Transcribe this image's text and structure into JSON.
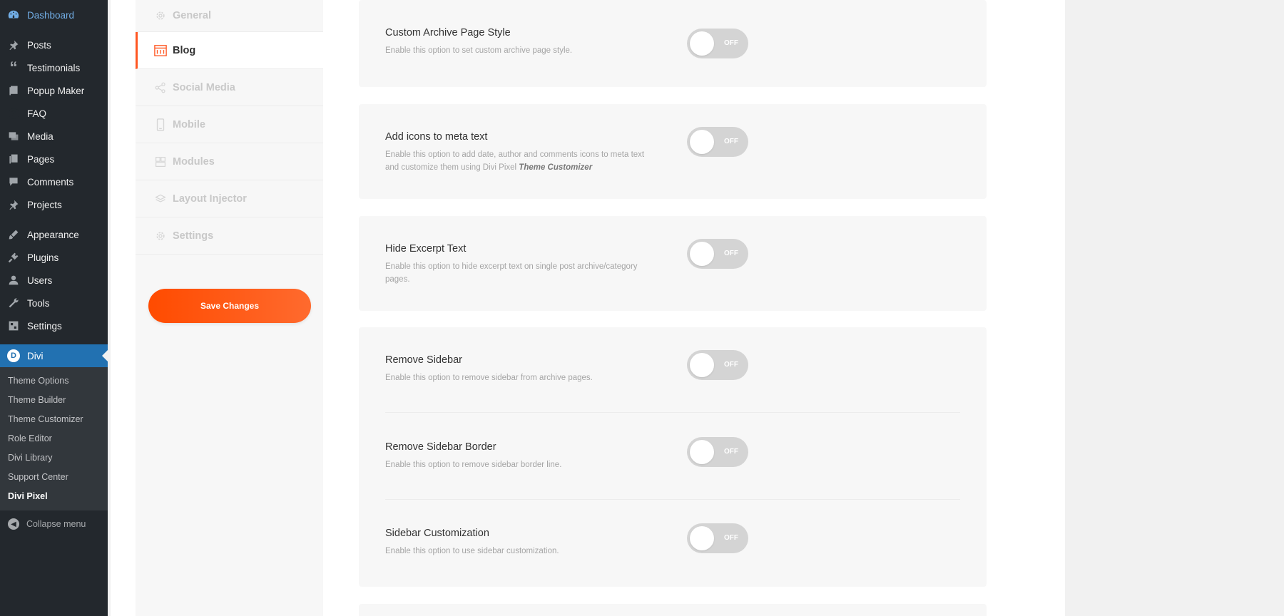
{
  "wp_menu": {
    "dashboard": "Dashboard",
    "posts": "Posts",
    "testimonials": "Testimonials",
    "popup_maker": "Popup Maker",
    "faq": "FAQ",
    "media": "Media",
    "pages": "Pages",
    "comments": "Comments",
    "projects": "Projects",
    "appearance": "Appearance",
    "plugins": "Plugins",
    "users": "Users",
    "tools": "Tools",
    "settings": "Settings",
    "divi": "Divi",
    "divi_logo_letter": "D",
    "collapse": "Collapse menu"
  },
  "divi_submenu": [
    "Theme Options",
    "Theme Builder",
    "Theme Customizer",
    "Role Editor",
    "Divi Library",
    "Support Center",
    "Divi Pixel"
  ],
  "plugin_nav": {
    "general": "General",
    "blog": "Blog",
    "social_media": "Social Media",
    "mobile": "Mobile",
    "modules": "Modules",
    "layout_injector": "Layout Injector",
    "settings": "Settings",
    "save": "Save Changes"
  },
  "options": {
    "custom_archive": {
      "title": "Custom Archive Page Style",
      "desc": "Enable this option to set custom archive page style.",
      "state": "OFF"
    },
    "meta_icons": {
      "title": "Add icons to meta text",
      "desc": "Enable this option to add date, author and comments icons to meta text and customize them using Divi Pixel",
      "desc_em": "Theme Customizer",
      "state": "OFF"
    },
    "hide_excerpt": {
      "title": "Hide Excerpt Text",
      "desc": "Enable this option to hide excerpt text on single post archive/category pages.",
      "state": "OFF"
    },
    "remove_sidebar": {
      "title": "Remove Sidebar",
      "desc": "Enable this option to remove sidebar from archive pages.",
      "state": "OFF"
    },
    "remove_sidebar_border": {
      "title": "Remove Sidebar Border",
      "desc": "Enable this option to remove sidebar border line.",
      "state": "OFF"
    },
    "sidebar_custom": {
      "title": "Sidebar Customization",
      "desc": "Enable this option to use sidebar customization.",
      "state": "OFF"
    }
  },
  "colors": {
    "accent": "#ff5722",
    "wp_active": "#2271b1",
    "toggle_off": "#d4d4d4"
  }
}
